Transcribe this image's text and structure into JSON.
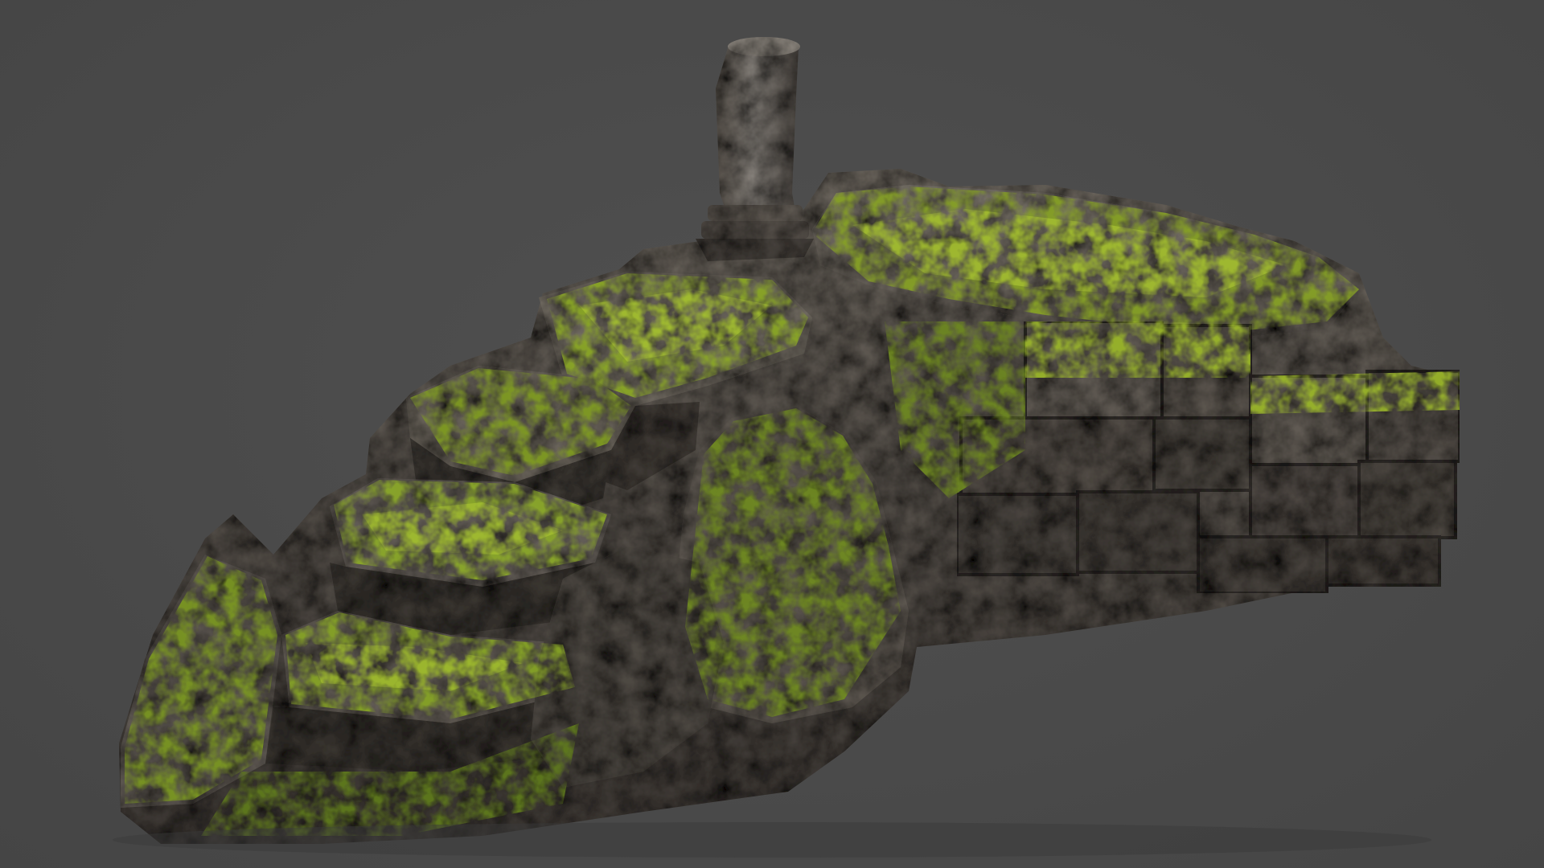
{
  "scene": {
    "subject": "moss-rock-ruin-model",
    "colors": {
      "background": "#4a4a4a",
      "rock_dark": "#3b3733",
      "rock_mid": "#5d5750",
      "rock_light": "#8a847b",
      "moss_dark": "#5c6e1c",
      "moss": "#7f9a24",
      "moss_bright": "#a6bf2e"
    }
  }
}
